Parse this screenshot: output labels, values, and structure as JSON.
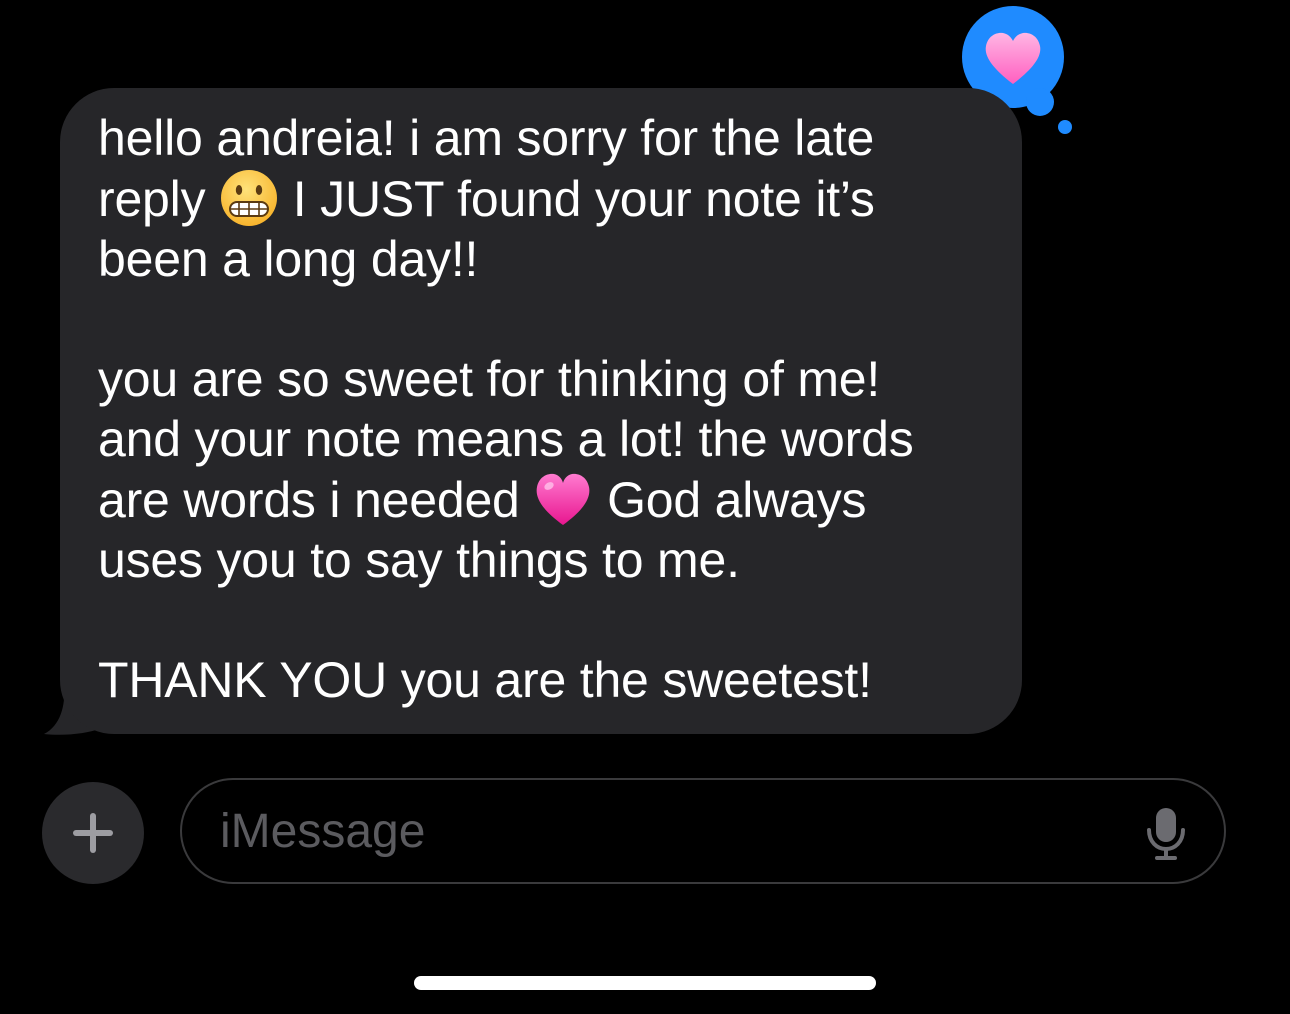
{
  "conversation": {
    "message": {
      "lines": [
        {
          "pre": "hello andreia! i am sorry for the late",
          "emoji": null,
          "post": ""
        },
        {
          "pre": "reply ",
          "emoji": "grimacing-face-emoji",
          "post": " I JUST found your note it’s"
        },
        {
          "pre": "been a long day!!",
          "emoji": null,
          "post": ""
        },
        {
          "pre": "you are so sweet for thinking of me!",
          "emoji": null,
          "post": ""
        },
        {
          "pre": "and your note means a lot! the words",
          "emoji": null,
          "post": ""
        },
        {
          "pre": "are words i needed ",
          "emoji": "pink-heart-emoji",
          "post": " God always"
        },
        {
          "pre": "uses you to say things to me.",
          "emoji": null,
          "post": ""
        },
        {
          "pre": "THANK YOU you are the sweetest!",
          "emoji": null,
          "post": ""
        }
      ],
      "tapback": {
        "icon": "pink-heart-icon",
        "bubble_color": "#1f8bff"
      }
    }
  },
  "composer": {
    "add_icon": "plus-icon",
    "placeholder": "iMessage",
    "value": "",
    "mic_icon": "microphone-icon"
  },
  "colors": {
    "background": "#000000",
    "bubble": "#262629",
    "text": "#ffffff",
    "placeholder": "#5b5b5f",
    "accent": "#1f8bff",
    "heart": "#ff4fb8"
  }
}
